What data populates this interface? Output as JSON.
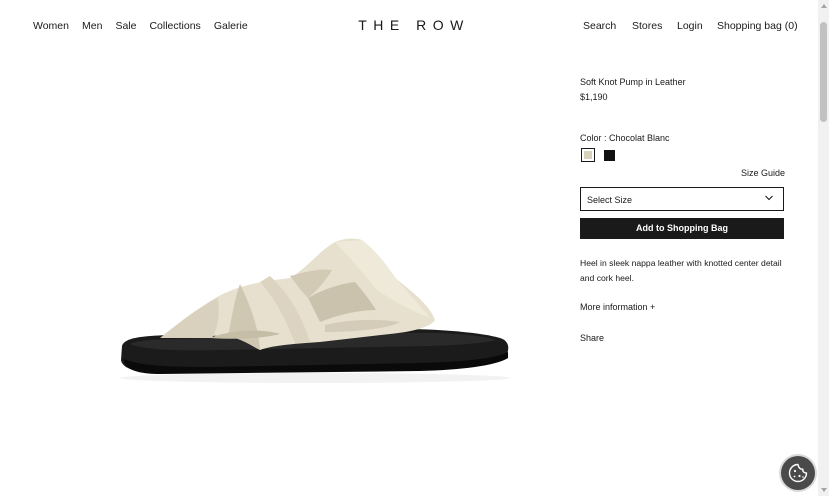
{
  "header": {
    "nav_left": [
      "Women",
      "Men",
      "Sale",
      "Collections",
      "Galerie"
    ],
    "logo": "THE ROW",
    "search": "Search",
    "stores": "Stores",
    "login": "Login",
    "bag": "Shopping bag (0)"
  },
  "product": {
    "title": "Soft Knot Pump in Leather",
    "price": "$1,190",
    "color_label": "Color : Chocolat Blanc",
    "swatches": [
      {
        "name": "Chocolat Blanc",
        "color": "#d8d1bd",
        "selected": true
      },
      {
        "name": "Black",
        "color": "#111111",
        "selected": false
      }
    ],
    "size_guide": "Size Guide",
    "size_select": "Select Size",
    "add_to_bag": "Add to Shopping Bag",
    "description": "Heel in sleek nappa leather with knotted center detail and cork heel.",
    "more_info": "More information +",
    "share": "Share"
  }
}
